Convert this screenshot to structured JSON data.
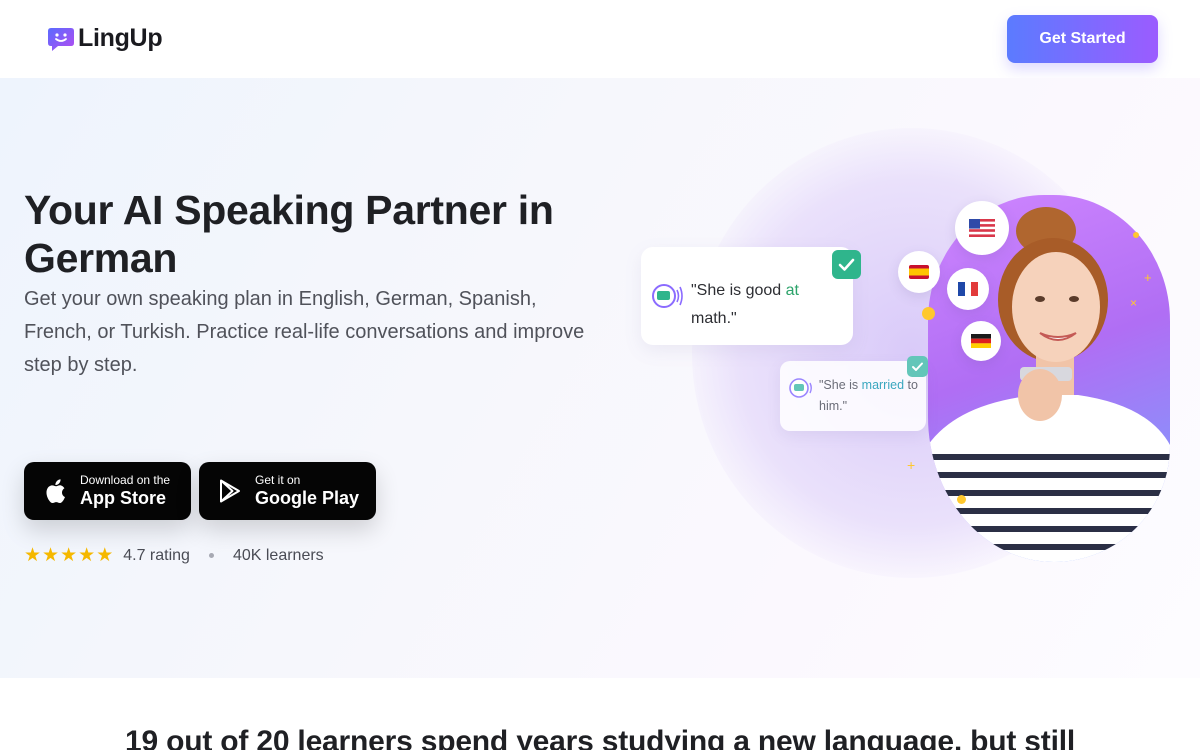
{
  "brand": {
    "name": "LingUp",
    "logo_icon": "speech-bubble-face-icon",
    "accent_gradient": [
      "#5b7bff",
      "#9b5cff"
    ]
  },
  "nav": {
    "cta_label": "Get Started"
  },
  "hero": {
    "title": "Your AI Speaking Partner in German",
    "subtitle": "Get your own speaking plan in English, German, Spanish, French, or Turkish. Practice real-life conversations and improve step by step.",
    "app_store": {
      "small": "Download on the",
      "big": "App Store",
      "icon": "apple-icon"
    },
    "google_play": {
      "small": "Get it on",
      "big": "Google Play",
      "icon": "google-play-icon"
    },
    "rating": {
      "stars": 5,
      "label": "4.7 rating",
      "learners": "40K learners",
      "star_color": "#f5b800"
    },
    "chat": {
      "bubble1": {
        "before": "\"She is good ",
        "highlight": "at",
        "after": " math.\""
      },
      "bubble2": {
        "before": "\"She is ",
        "highlight": "married",
        "after": " to him.\""
      }
    },
    "flags": [
      "us-flag-icon",
      "spain-flag-icon",
      "france-flag-icon",
      "germany-flag-icon"
    ]
  },
  "next_section": {
    "heading": "19 out of 20 learners spend years studying a new language, but still"
  }
}
